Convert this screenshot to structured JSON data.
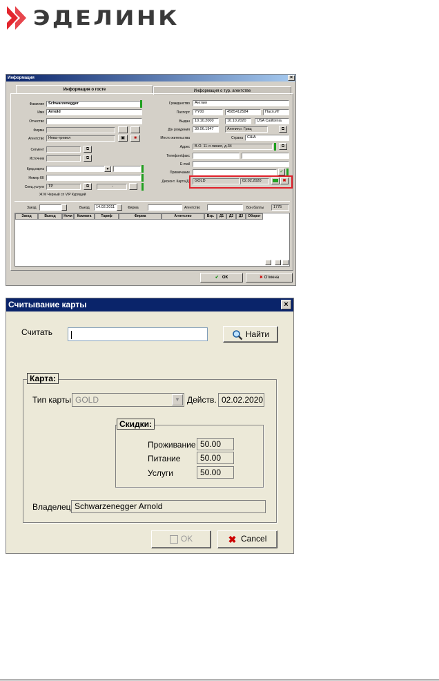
{
  "logo": {
    "text": "ЭДЕЛИНК"
  },
  "win1": {
    "title": "Информация",
    "tab_guest": "Информация о госте",
    "tab_agency": "Информация о тур. агентстве",
    "left": {
      "surname_lbl": "Фамилия",
      "surname": "Schwarzenegger",
      "name_lbl": "Имя",
      "name": "Arnold",
      "patronymic_lbl": "Отчество",
      "patronymic": "",
      "firm_lbl": "Фирма",
      "firm": "",
      "agency_lbl": "Агентство",
      "agency": "Нева-тревел",
      "segment_lbl": "Сегмент",
      "source_lbl": "Источник",
      "card_lbl": "Кред.карта",
      "kk_lbl": "Номер КК",
      "services_lbl": "Спец.услуги",
      "services": "TP",
      "dash": "-",
      "checks": "Ж  М  Черный сп   VIP   Курящий"
    },
    "right": {
      "citizen_lbl": "Гражданство",
      "citizen": "Англия",
      "passport_lbl": "Паспорт",
      "passport_ser": "YY00",
      "passport_no": "4585412584",
      "passport_type": "Пасп.ИГ",
      "issued_lbl": "Выдан",
      "issued_from": "10.10.2000",
      "issued_to": "10.10.2020",
      "issued_by": "USA California",
      "birth_lbl": "Д/н рождения",
      "birth": "30.06.1947",
      "birth_place": "Англия,г. Грац",
      "residence_lbl": "Место жительства",
      "country_lbl": "Страна",
      "country": "США",
      "address_lbl": "Адрес",
      "address": "В.О. 11-я линия, д.34",
      "phone_lbl": "Телефон/факс",
      "email_lbl": "E-mail",
      "note_lbl": "Примечание",
      "discount_lbl": "Дисконт. Карта/Д.",
      "discount_card": "GOLD",
      "discount_date": "02.02.2020"
    },
    "bottom": {
      "arrival_lbl": "Заезд",
      "departure_lbl": "Выезд",
      "departure": "14.02.2011",
      "firm_lbl": "Фирма",
      "agency_lbl": "Агентство",
      "bonus_lbl": "Бон.баллы",
      "bonus": "1775",
      "cols": [
        "Заезд",
        "Выезд",
        "Ночи",
        "Комната",
        "Тариф",
        "Фирма",
        "Агентство",
        "Взр.",
        "Д1",
        "Д2",
        "Д3",
        "Оборот"
      ]
    },
    "ok": "ОК",
    "cancel": "Отмена"
  },
  "win2": {
    "title": "Считывание карты",
    "read_lbl": "Считать",
    "read_val": "",
    "find": "Найти",
    "card_group": "Карта:",
    "card_type_lbl": "Тип карты",
    "card_type": "GOLD",
    "valid_lbl": "Действ.",
    "valid": "02.02.2020",
    "disc_group": "Скидки:",
    "lodging_lbl": "Проживание",
    "lodging": "50.00",
    "food_lbl": "Питание",
    "food": "50.00",
    "serv_lbl": "Услуги",
    "serv": "50.00",
    "owner_lbl": "Владелец:",
    "owner": "Schwarzenegger  Arnold",
    "ok": "OK",
    "cancel": "Cancel"
  },
  "colors": {
    "titlebar": "#0a246a",
    "highlight": "#e0202a",
    "accent_green": "#20a020"
  }
}
